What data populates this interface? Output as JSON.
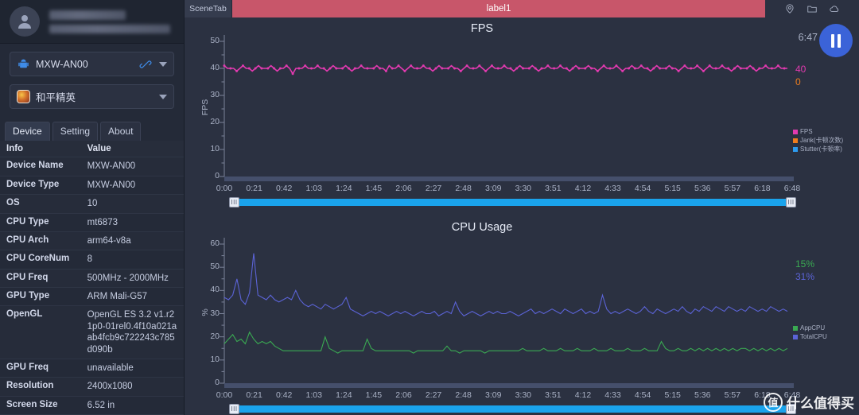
{
  "sidebar": {
    "profile": {
      "name_masked": true
    },
    "device_select": {
      "label": "MXW-AN00",
      "icon": "android-icon",
      "action_icon": "usb-link-icon"
    },
    "app_select": {
      "label": "和平精英",
      "icon": "game-app-icon"
    },
    "tabs": [
      {
        "label": "Device",
        "active": true
      },
      {
        "label": "Setting",
        "active": false
      },
      {
        "label": "About",
        "active": false
      }
    ],
    "table": {
      "headers": [
        "Info",
        "Value"
      ],
      "rows": [
        [
          "Device Name",
          "MXW-AN00"
        ],
        [
          "Device Type",
          "MXW-AN00"
        ],
        [
          "OS",
          "10"
        ],
        [
          "CPU Type",
          "mt6873"
        ],
        [
          "CPU Arch",
          "arm64-v8a"
        ],
        [
          "CPU CoreNum",
          "8"
        ],
        [
          "CPU Freq",
          "500MHz - 2000MHz"
        ],
        [
          "GPU Type",
          "ARM Mali-G57"
        ],
        [
          "OpenGL",
          "OpenGL ES 3.2 v1.r21p0-01rel0.4f10a021aab4fcb9c722243c785d090b"
        ],
        [
          "GPU Freq",
          "unavailable"
        ],
        [
          "Resolution",
          "2400x1080"
        ],
        [
          "Screen Size",
          "6.52 in"
        ]
      ]
    }
  },
  "topbar": {
    "scene_tab": "SceneTab",
    "label": "label1",
    "label_color": "#c8566a",
    "icons": [
      "location-pin-icon",
      "folder-icon",
      "cloud-icon"
    ]
  },
  "controls": {
    "timer": "6:47",
    "pause_label": "pause-button"
  },
  "watermark": {
    "mark": "值",
    "text": "什么值得买"
  },
  "chart_data": [
    {
      "type": "line",
      "title": "FPS",
      "ylabel": "FPS",
      "xlabel": "",
      "ylim": [
        0,
        50
      ],
      "yticks": [
        0,
        10,
        20,
        30,
        40,
        50
      ],
      "xticks": [
        "0:00",
        "0:21",
        "0:42",
        "1:03",
        "1:24",
        "1:45",
        "2:06",
        "2:27",
        "2:48",
        "3:09",
        "3:30",
        "3:51",
        "4:12",
        "4:33",
        "4:54",
        "5:15",
        "5:36",
        "5:57",
        "6:18",
        "6:48"
      ],
      "grid": false,
      "legend_position": "right",
      "legend": [
        {
          "name": "FPS",
          "color": "#e23ab0"
        },
        {
          "name": "Jank(卡顿次数)",
          "color": "#ef7d1e"
        },
        {
          "name": "Stutter(卡顿率)",
          "color": "#2d9cf0"
        }
      ],
      "current_values": [
        {
          "label": "40",
          "color": "#e23ab0"
        },
        {
          "label": "0",
          "color": "#ef7d1e"
        }
      ],
      "series": [
        {
          "name": "FPS",
          "color": "#e23ab0",
          "values": [
            41,
            40,
            40,
            40,
            39,
            40,
            41,
            40,
            40,
            39,
            40,
            41,
            40,
            40,
            40,
            41,
            40,
            39,
            40,
            40,
            41,
            40,
            38,
            40,
            40,
            40,
            41,
            40,
            40,
            40,
            41,
            40,
            40,
            39,
            40,
            41,
            40,
            40,
            40,
            41,
            40,
            39,
            40,
            40,
            41,
            40,
            40,
            40,
            40,
            41,
            40,
            40,
            39,
            41,
            40,
            40,
            41,
            40,
            39,
            40,
            41,
            40,
            40,
            40,
            41,
            40,
            40,
            39,
            40,
            41,
            40,
            40,
            40,
            41,
            40,
            40,
            39,
            40,
            41,
            40,
            40,
            40,
            41,
            40,
            39,
            40,
            41,
            40,
            40,
            40,
            41,
            40,
            40,
            39,
            40,
            41,
            40,
            40,
            40,
            41,
            40,
            39,
            40,
            40,
            41,
            40,
            40,
            40,
            41,
            40,
            40,
            39,
            40,
            41,
            40,
            40,
            40,
            41,
            40,
            40,
            39,
            40,
            41,
            40,
            40,
            40,
            41,
            40,
            39,
            40,
            40,
            41,
            40,
            40,
            41,
            40,
            40,
            39,
            40,
            41,
            40,
            40,
            40,
            41,
            40,
            40,
            39,
            40,
            41,
            40,
            40,
            40,
            41,
            40,
            39,
            40,
            41,
            40,
            40,
            40,
            41,
            40,
            40,
            39,
            40,
            41,
            40,
            40,
            40,
            41,
            40,
            39,
            40,
            40,
            41,
            40,
            40,
            40,
            41,
            40,
            40,
            40
          ]
        }
      ]
    },
    {
      "type": "line",
      "title": "CPU Usage",
      "ylabel": "%",
      "xlabel": "",
      "ylim": [
        0,
        60
      ],
      "yticks": [
        0,
        10,
        20,
        30,
        40,
        50,
        60
      ],
      "xticks": [
        "0:00",
        "0:21",
        "0:42",
        "1:03",
        "1:24",
        "1:45",
        "2:06",
        "2:27",
        "2:48",
        "3:09",
        "3:30",
        "3:51",
        "4:12",
        "4:33",
        "4:54",
        "5:15",
        "5:36",
        "5:57",
        "6:18",
        "6:48"
      ],
      "grid": false,
      "legend_position": "right",
      "legend": [
        {
          "name": "AppCPU",
          "color": "#3aa952"
        },
        {
          "name": "TotalCPU",
          "color": "#5b63d6"
        }
      ],
      "current_values": [
        {
          "label": "15%",
          "color": "#3aa952"
        },
        {
          "label": "31%",
          "color": "#5b63d6"
        }
      ],
      "series": [
        {
          "name": "TotalCPU",
          "color": "#5b63d6",
          "values": [
            37,
            36,
            38,
            45,
            36,
            34,
            39,
            56,
            38,
            37,
            36,
            38,
            36,
            35,
            36,
            37,
            36,
            40,
            36,
            34,
            33,
            34,
            33,
            32,
            34,
            33,
            32,
            33,
            34,
            37,
            32,
            31,
            30,
            29,
            30,
            31,
            30,
            31,
            30,
            29,
            30,
            31,
            30,
            31,
            30,
            29,
            30,
            31,
            30,
            30,
            31,
            29,
            30,
            31,
            30,
            35,
            31,
            29,
            30,
            31,
            30,
            29,
            30,
            31,
            30,
            31,
            30,
            30,
            31,
            30,
            29,
            30,
            31,
            32,
            30,
            31,
            30,
            31,
            32,
            31,
            30,
            32,
            31,
            30,
            31,
            32,
            30,
            31,
            30,
            31,
            38,
            32,
            30,
            31,
            30,
            31,
            32,
            31,
            30,
            31,
            33,
            31,
            30,
            32,
            31,
            30,
            31,
            32,
            31,
            33,
            31,
            30,
            32,
            31,
            33,
            32,
            31,
            33,
            32,
            31,
            33,
            32,
            31,
            32,
            31,
            33,
            32,
            31,
            32,
            31,
            33,
            32,
            31,
            32,
            31
          ]
        },
        {
          "name": "AppCPU",
          "color": "#3aa952",
          "values": [
            17,
            19,
            21,
            18,
            19,
            17,
            22,
            19,
            17,
            18,
            17,
            18,
            16,
            15,
            14,
            14,
            14,
            14,
            14,
            14,
            14,
            14,
            14,
            14,
            20,
            15,
            14,
            13,
            14,
            14,
            14,
            14,
            14,
            14,
            19,
            15,
            14,
            14,
            14,
            14,
            14,
            14,
            14,
            14,
            14,
            13,
            14,
            14,
            14,
            14,
            14,
            14,
            14,
            16,
            14,
            14,
            13,
            14,
            14,
            14,
            14,
            14,
            13,
            14,
            14,
            14,
            14,
            14,
            14,
            14,
            14,
            15,
            14,
            14,
            14,
            14,
            15,
            14,
            14,
            14,
            15,
            14,
            14,
            14,
            15,
            14,
            14,
            14,
            15,
            14,
            14,
            14,
            15,
            14,
            14,
            14,
            15,
            14,
            14,
            14,
            15,
            14,
            14,
            14,
            18,
            15,
            14,
            14,
            15,
            14,
            14,
            15,
            14,
            15,
            14,
            15,
            14,
            15,
            14,
            15,
            14,
            15,
            14,
            15,
            15,
            14,
            15,
            14,
            15,
            14,
            15,
            14,
            15,
            14,
            15
          ]
        }
      ]
    }
  ]
}
